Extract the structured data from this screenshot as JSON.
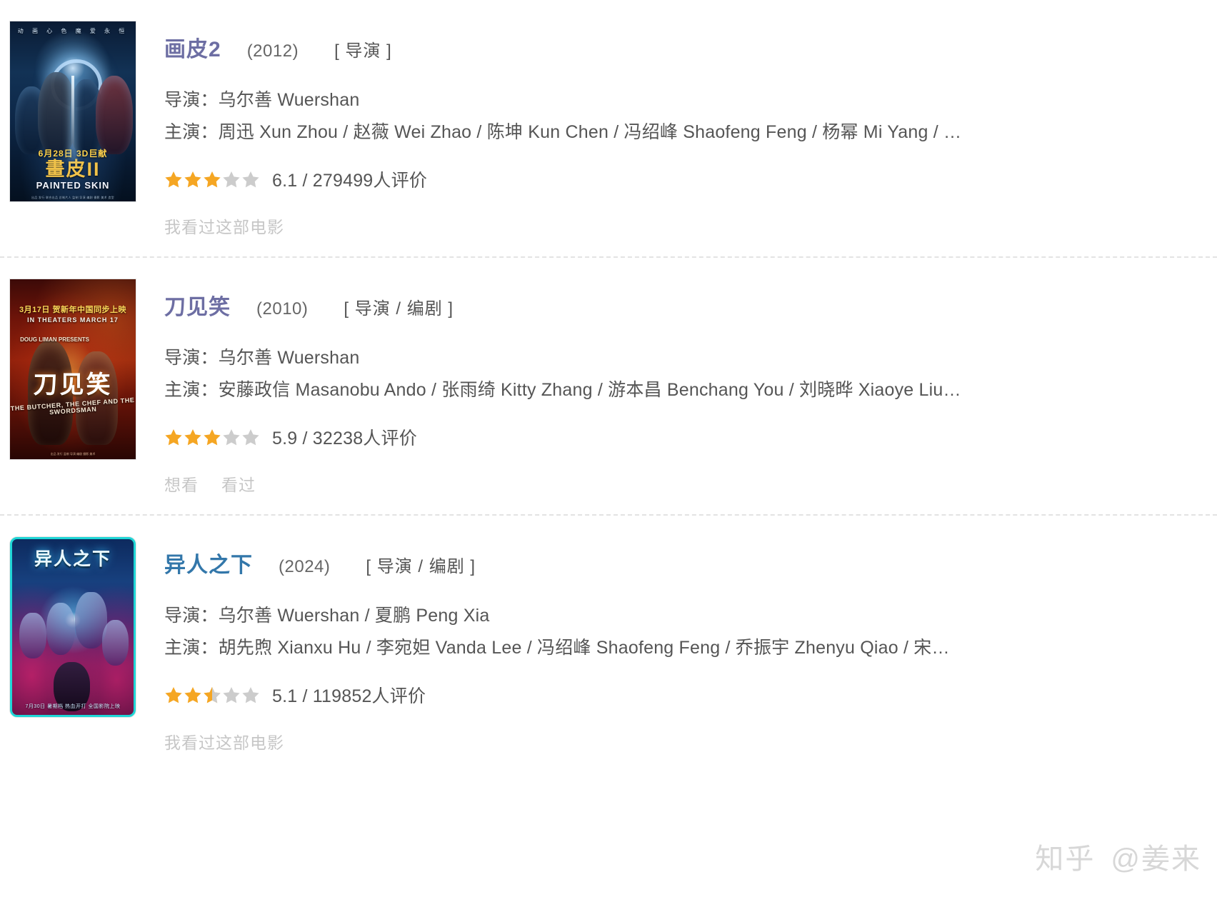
{
  "watermark": {
    "brand": "知乎",
    "handle": "@姜来"
  },
  "labels": {
    "director_label": "导演：",
    "cast_label": "主演："
  },
  "colors": {
    "visited_link": "#6d6ea3",
    "unvisited_link": "#3377aa",
    "star_filled": "#f5a623",
    "star_empty": "#cccccc",
    "body_text": "#555555",
    "muted_action": "#c6c6c6",
    "separator": "#e3e3e3"
  },
  "movies": [
    {
      "title": "画皮2",
      "title_state": "visited",
      "year": "(2012)",
      "roles": "[ 导演 ]",
      "director_label": "导演：",
      "directors": "乌尔善 Wuershan",
      "cast_label": "主演：",
      "cast": "周迅 Xun Zhou / 赵薇 Wei Zhao / 陈坤 Kun Chen / 冯绍峰 Shaofeng Feng / 杨幂 Mi Yang / …",
      "rating_value": "6.1",
      "rating_count": "279499",
      "rating_text": "6.1 / 279499人评价",
      "stars": 3,
      "half_star": false,
      "actions": [
        "我看过这部电影"
      ],
      "poster": {
        "class": "p1",
        "top_caption": "动 画 心 色    魔 爱 永 恒",
        "date_caption": "6月28日  3D巨献",
        "cn_title": "畫皮II",
        "en_title": "PAINTED SKIN",
        "credits": "出品 发行 联合出品 总制片人 监制 导演 编剧 摄影 美术 造型"
      }
    },
    {
      "title": "刀见笑",
      "title_state": "visited",
      "year": "(2010)",
      "roles": "[ 导演 / 编剧 ]",
      "director_label": "导演：",
      "directors": "乌尔善 Wuershan",
      "cast_label": "主演：",
      "cast": "安藤政信 Masanobu Ando / 张雨绮 Kitty Zhang / 游本昌 Benchang You / 刘晓晔 Xiaoye Liu…",
      "rating_value": "5.9",
      "rating_count": "32238",
      "rating_text": "5.9 / 32238人评价",
      "stars": 3,
      "half_star": false,
      "actions": [
        "想看",
        "看过"
      ],
      "poster": {
        "class": "p2",
        "date_caption": "3月17日 贺新年中国同步上映",
        "sub_caption": "IN THEATERS MARCH 17",
        "presents": "DOUG LIMAN PRESENTS",
        "cn_title": "刀见笑",
        "en_title": "THE BUTCHER, THE CHEF AND THE SWORDSMAN",
        "credits": "出品 发行 监制 导演 编剧 摄影 美术"
      }
    },
    {
      "title": "异人之下",
      "title_state": "unvisited",
      "year": "(2024)",
      "roles": "[ 导演 / 编剧 ]",
      "director_label": "导演：",
      "directors": "乌尔善 Wuershan / 夏鹏 Peng Xia",
      "cast_label": "主演：",
      "cast": "胡先煦 Xianxu Hu / 李宛妲 Vanda Lee / 冯绍峰 Shaofeng Feng / 乔振宇 Zhenyu Qiao / 宋…",
      "rating_value": "5.1",
      "rating_count": "119852",
      "rating_text": "5.1 / 119852人评价",
      "stars": 2,
      "half_star": true,
      "actions": [
        "我看过这部电影"
      ],
      "poster": {
        "class": "p3",
        "cn_title": "异人之下",
        "date_caption": "7月30日 暑期档 热血开打 全国影院上映"
      }
    }
  ]
}
